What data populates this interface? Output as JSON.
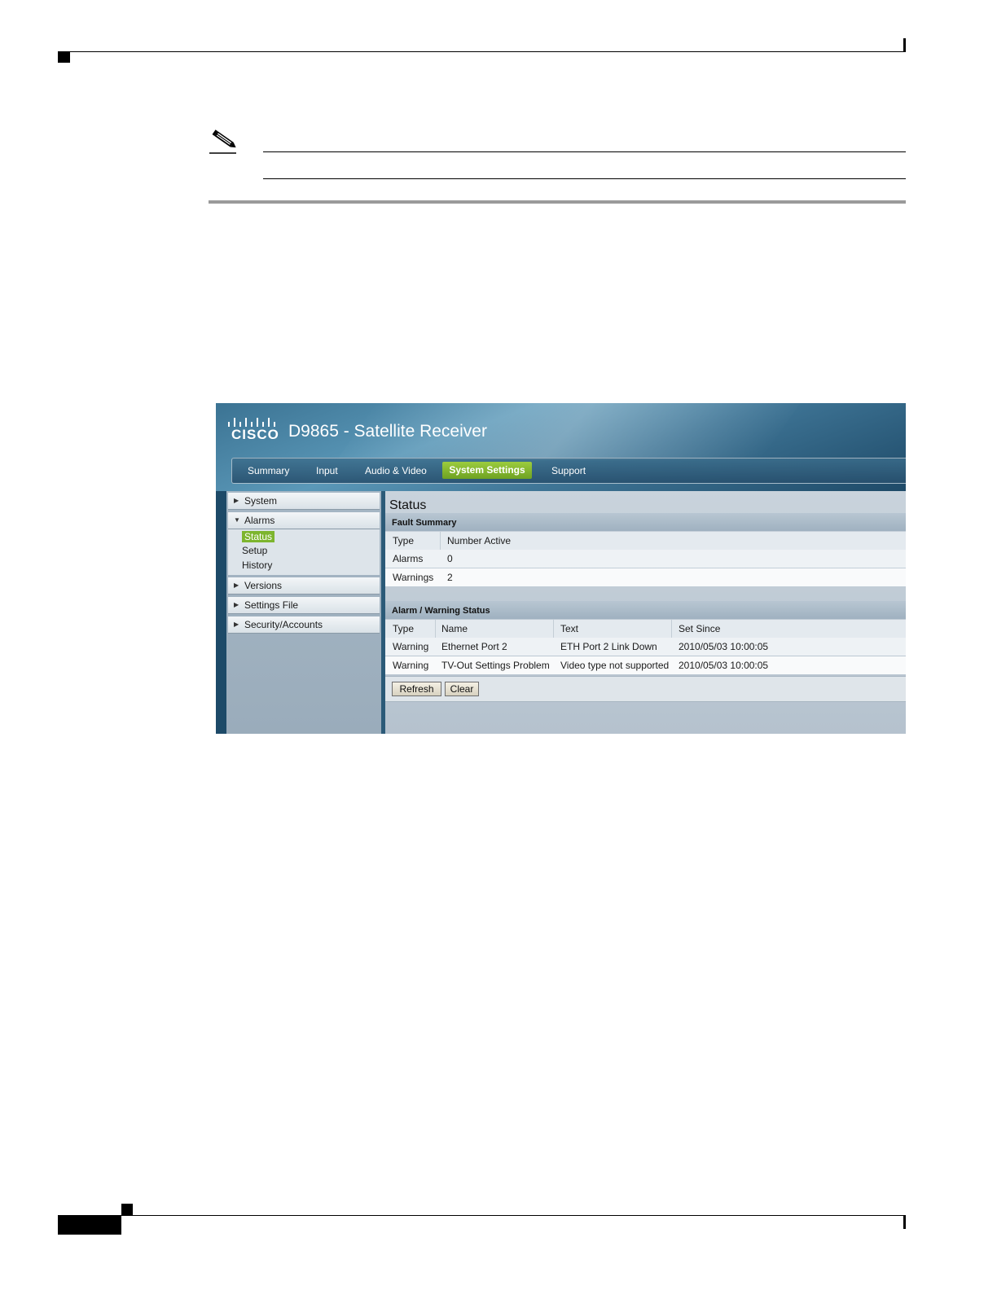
{
  "app": {
    "brand": "CISCO",
    "title": "D9865 - Satellite Receiver"
  },
  "nav": {
    "tabs": [
      {
        "label": "Summary"
      },
      {
        "label": "Input"
      },
      {
        "label": "Audio & Video"
      },
      {
        "label": "System Settings",
        "active": true
      },
      {
        "label": "Support"
      }
    ]
  },
  "sidebar": {
    "items": [
      {
        "label": "System"
      },
      {
        "label": "Alarms",
        "expanded": true
      },
      {
        "label": "Versions"
      },
      {
        "label": "Settings File"
      },
      {
        "label": "Security/Accounts"
      }
    ],
    "alarms_sub": [
      {
        "label": "Status",
        "active": true
      },
      {
        "label": "Setup"
      },
      {
        "label": "History"
      }
    ]
  },
  "main": {
    "title": "Status",
    "fault_summary": {
      "header": "Fault Summary",
      "columns": [
        "Type",
        "Number Active"
      ],
      "rows": [
        [
          "Alarms",
          "0"
        ],
        [
          "Warnings",
          "2"
        ]
      ]
    },
    "alarm_status": {
      "header": "Alarm / Warning Status",
      "columns": [
        "Type",
        "Name",
        "Text",
        "Set Since"
      ],
      "rows": [
        [
          "Warning",
          "Ethernet Port 2",
          "ETH Port 2 Link Down",
          "2010/05/03 10:00:05"
        ],
        [
          "Warning",
          "TV-Out Settings Problem",
          "Video type not supported",
          "2010/05/03 10:00:05"
        ]
      ]
    },
    "buttons": {
      "refresh": "Refresh",
      "clear": "Clear"
    }
  },
  "colors": {
    "active_tab": "#7db52e",
    "banner": "#3b7393"
  },
  "icons": {
    "note": "pencil-note-icon",
    "logo": "cisco-logo-icon"
  }
}
